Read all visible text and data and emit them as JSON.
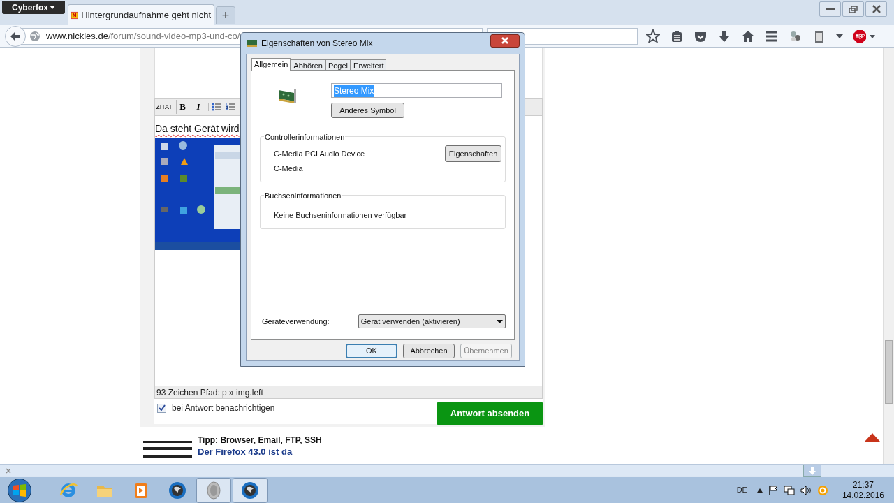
{
  "browser": {
    "app_button": "Cyberfox",
    "tabs": [
      {
        "title": "Hintergrundaufnahme geht nicht",
        "selected": true
      }
    ],
    "new_tab": "+",
    "url": {
      "host": "www.nickles.de",
      "path": "/forum/sound-video-mp3-und-co/"
    }
  },
  "editor": {
    "toolbar": [
      {
        "kind": "quote",
        "label": "ZITAT"
      },
      {
        "kind": "bold",
        "label": "B"
      },
      {
        "kind": "italic",
        "label": "I"
      },
      {
        "kind": "bullets"
      },
      {
        "kind": "numbers"
      }
    ],
    "text": "Da steht Gerät wird",
    "status": "93 Zeichen Pfad: p » img.left",
    "notify": {
      "label": "bei Antwort benachrichtigen",
      "checked": true
    },
    "submit": "Antwort absenden"
  },
  "tip": {
    "heading": "Tipp: Browser, Email, FTP, SSH",
    "link": "Der Firefox 43.0 ist da"
  },
  "dialog": {
    "title": "Eigenschaften von Stereo Mix",
    "tabs": [
      {
        "label": "Allgemein",
        "selected": true
      },
      {
        "label": "Abhören",
        "selected": false
      },
      {
        "label": "Pegel",
        "selected": false
      },
      {
        "label": "Erweitert",
        "selected": false
      }
    ],
    "name": {
      "value": "Stereo Mix",
      "selected": true
    },
    "change_icon": "Anderes Symbol",
    "controller": {
      "title": "Controllerinformationen",
      "device": "C-Media PCI Audio Device",
      "vendor": "C-Media",
      "button": "Eigenschaften"
    },
    "jack": {
      "title": "Buchseninformationen",
      "text": "Keine Buchseninformationen verfügbar"
    },
    "usage": {
      "label": "Geräteverwendung:",
      "value": "Gerät verwenden (aktivieren)"
    },
    "buttons": [
      {
        "label": "OK",
        "default": true,
        "disabled": false
      },
      {
        "label": "Abbrechen",
        "default": false,
        "disabled": false
      },
      {
        "label": "Übernehmen",
        "default": false,
        "disabled": true
      }
    ]
  },
  "taskbar": {
    "apps": [
      {
        "kind": "ie",
        "active": false
      },
      {
        "kind": "folder",
        "active": false
      },
      {
        "kind": "media",
        "active": false
      },
      {
        "kind": "globe",
        "active": false
      },
      {
        "kind": "speaker",
        "active": true
      },
      {
        "kind": "globe",
        "active": true
      }
    ],
    "language": "DE",
    "time": "21:37",
    "date": "14.02.2016"
  }
}
